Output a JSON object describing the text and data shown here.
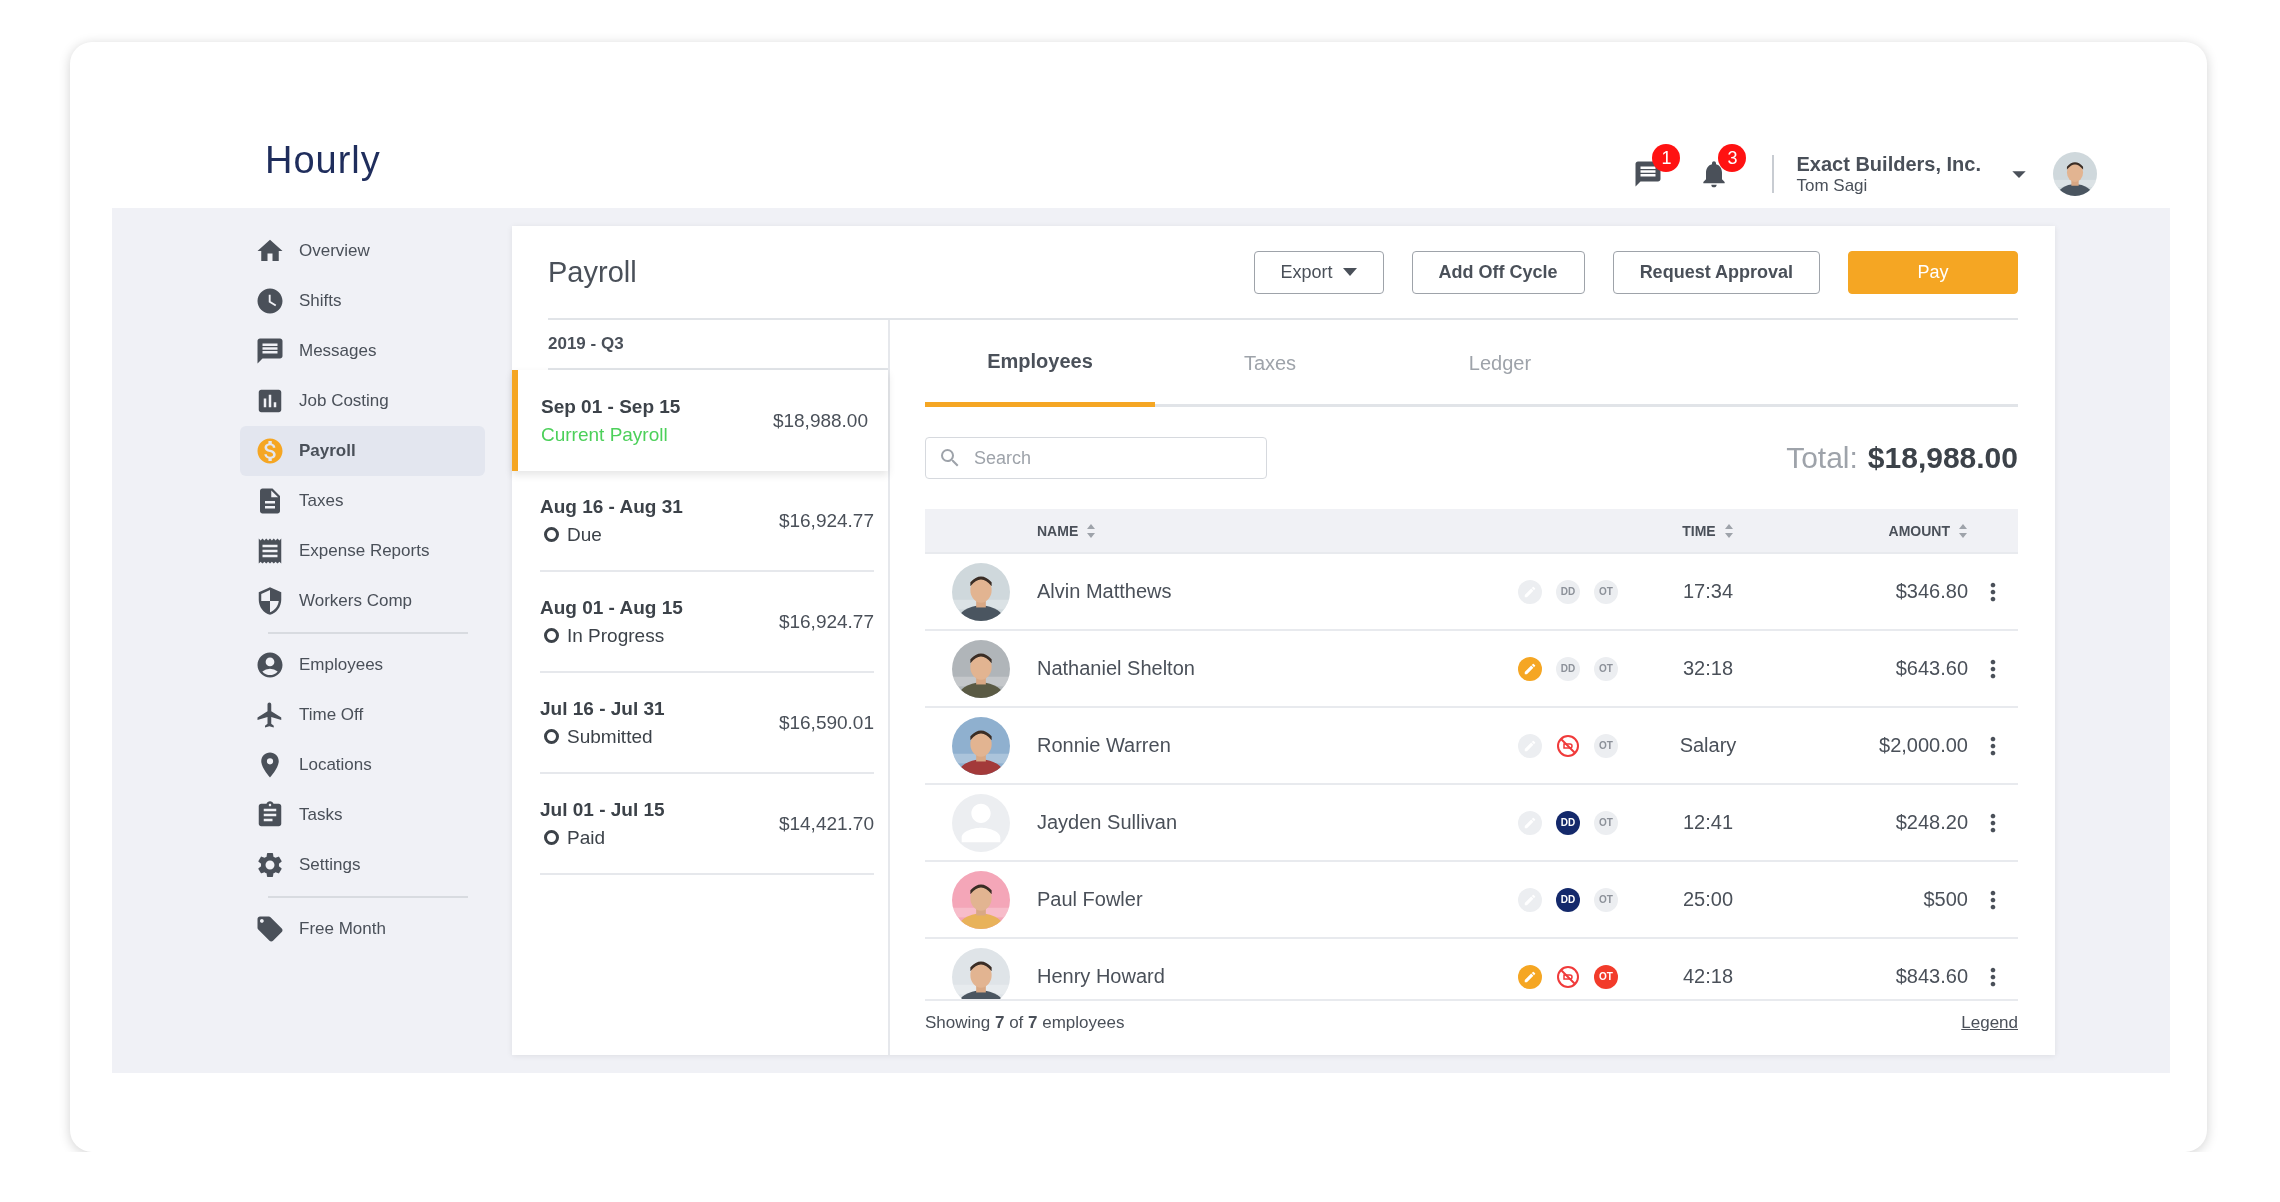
{
  "header": {
    "logo": "Hourly",
    "messages_badge": "1",
    "notifications_badge": "3",
    "company": "Exact Builders, Inc.",
    "user": "Tom Sagi"
  },
  "sidebar": {
    "sections": [
      [
        {
          "label": "Overview",
          "selected": false
        },
        {
          "label": "Shifts",
          "selected": false
        },
        {
          "label": "Messages",
          "selected": false
        },
        {
          "label": "Job Costing",
          "selected": false
        },
        {
          "label": "Payroll",
          "selected": true
        },
        {
          "label": "Taxes",
          "selected": false
        },
        {
          "label": "Expense Reports",
          "selected": false
        },
        {
          "label": "Workers Comp",
          "selected": false
        }
      ],
      [
        {
          "label": "Employees",
          "selected": false
        },
        {
          "label": "Time Off",
          "selected": false
        },
        {
          "label": "Locations",
          "selected": false
        },
        {
          "label": "Tasks",
          "selected": false
        },
        {
          "label": "Settings",
          "selected": false
        }
      ],
      [
        {
          "label": "Free Month",
          "selected": false
        }
      ]
    ]
  },
  "page": {
    "title": "Payroll",
    "buttons": [
      {
        "label": "Export",
        "kind": "dropdown"
      },
      {
        "label": "Add Off Cycle",
        "kind": "outline"
      },
      {
        "label": "Request Approval",
        "kind": "outline"
      },
      {
        "label": "Pay",
        "kind": "primary"
      }
    ]
  },
  "periods": {
    "group": "2019 - Q3",
    "items": [
      {
        "range": "Sep 01 - Sep 15",
        "status": "Current Payroll",
        "amount": "$18,988.00",
        "selected": true
      },
      {
        "range": "Aug 16 - Aug 31",
        "status": "Due",
        "amount": "$16,924.77",
        "selected": false
      },
      {
        "range": "Aug 01 - Aug 15",
        "status": "In Progress",
        "amount": "$16,924.77",
        "selected": false
      },
      {
        "range": "Jul 16 - Jul 31",
        "status": "Submitted",
        "amount": "$16,590.01",
        "selected": false
      },
      {
        "range": "Jul 01 - Jul 15",
        "status": "Paid",
        "amount": "$14,421.70",
        "selected": false
      }
    ]
  },
  "tabs": [
    {
      "label": "Employees",
      "selected": true
    },
    {
      "label": "Taxes",
      "selected": false
    },
    {
      "label": "Ledger",
      "selected": false
    }
  ],
  "search": {
    "placeholder": "Search"
  },
  "total": {
    "label": "Total:",
    "value": "$18,988.00"
  },
  "table": {
    "columns": [
      "NAME",
      "TIME",
      "AMOUNT"
    ],
    "rows": [
      {
        "has_photo": true,
        "name": "Alvin Matthews",
        "edited": false,
        "dd": {
          "label": "DD",
          "on": false,
          "blocked": false
        },
        "ot": {
          "label": "OT",
          "on": false
        },
        "time": "17:34",
        "amount": "$346.80"
      },
      {
        "has_photo": true,
        "name": "Nathaniel Shelton",
        "edited": true,
        "dd": {
          "label": "DD",
          "on": false,
          "blocked": false
        },
        "ot": {
          "label": "OT",
          "on": false
        },
        "time": "32:18",
        "amount": "$643.60"
      },
      {
        "has_photo": true,
        "name": "Ronnie Warren",
        "edited": false,
        "dd": {
          "blocked": true
        },
        "ot": {
          "label": "OT",
          "on": false
        },
        "time": "Salary",
        "amount": "$2,000.00"
      },
      {
        "has_photo": false,
        "name": "Jayden Sullivan",
        "edited": false,
        "dd": {
          "label": "DD",
          "on": true,
          "blocked": false
        },
        "ot": {
          "label": "OT",
          "on": false
        },
        "time": "12:41",
        "amount": "$248.20"
      },
      {
        "has_photo": true,
        "name": "Paul Fowler",
        "edited": false,
        "dd": {
          "label": "DD",
          "on": true,
          "blocked": false
        },
        "ot": {
          "label": "OT",
          "on": false
        },
        "time": "25:00",
        "amount": "$500"
      },
      {
        "has_photo": true,
        "name": "Henry Howard",
        "edited": true,
        "dd": {
          "blocked": true
        },
        "ot": {
          "label": "OT",
          "on": true
        },
        "time": "42:18",
        "amount": "$843.60"
      }
    ]
  },
  "footer": {
    "summary": "Showing **7** of **7** employees",
    "legend": "Legend"
  }
}
